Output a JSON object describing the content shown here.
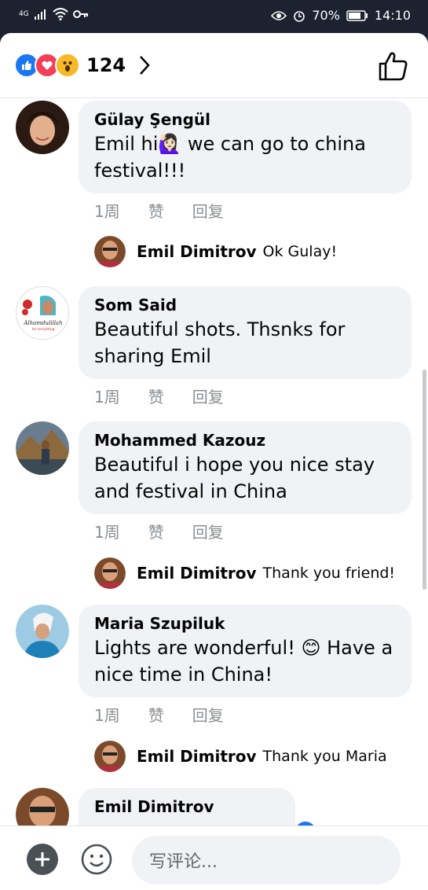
{
  "status_bar": {
    "network": "4G",
    "battery": "70%",
    "time": "14:10"
  },
  "header": {
    "reactions": [
      "like-icon",
      "love-icon",
      "wow-icon"
    ],
    "reaction_count": "124"
  },
  "comments": [
    {
      "author": "Gülay Şengül",
      "text_line1": "Emil hi🙋🏻‍♀️ we can go to china",
      "text_line2": "festival!!!",
      "time": "1周",
      "like": "赞",
      "reply": "回复",
      "replies": [
        {
          "author": "Emil Dimitrov",
          "text": "Ok Gulay!"
        }
      ]
    },
    {
      "author": "Som Said",
      "text_line1": "Beautiful shots. Thsnks for",
      "text_line2": "sharing Emil",
      "time": "1周",
      "like": "赞",
      "reply": "回复",
      "avatar_caption": "Alhamdulillah",
      "avatar_subcaption": "for everything"
    },
    {
      "author": "Mohammed Kazouz",
      "text_line1": "Beautiful i hope you nice stay",
      "text_line2": "and festival in China",
      "time": "1周",
      "like": "赞",
      "reply": "回复",
      "replies": [
        {
          "author": "Emil Dimitrov",
          "text": "Thank you friend!"
        }
      ]
    },
    {
      "author": "Maria Szupiluk",
      "text_line1": "Lights are wonderful! 😊 Have a",
      "text_line2": "nice time in China!",
      "time": "1周",
      "like": "赞",
      "reply": "回复",
      "replies": [
        {
          "author": "Emil Dimitrov",
          "text": "Thank you Maria"
        }
      ]
    },
    {
      "author": "Emil Dimitrov"
    }
  ],
  "composer": {
    "placeholder": "写评论..."
  },
  "colors": {
    "status_bar_bg": "#1c2230",
    "bubble_bg": "#f0f2f5",
    "like_blue": "#1877f2",
    "love_red": "#f33e58",
    "wow_yellow": "#f7b928",
    "meta_gray": "#8a8d91"
  }
}
